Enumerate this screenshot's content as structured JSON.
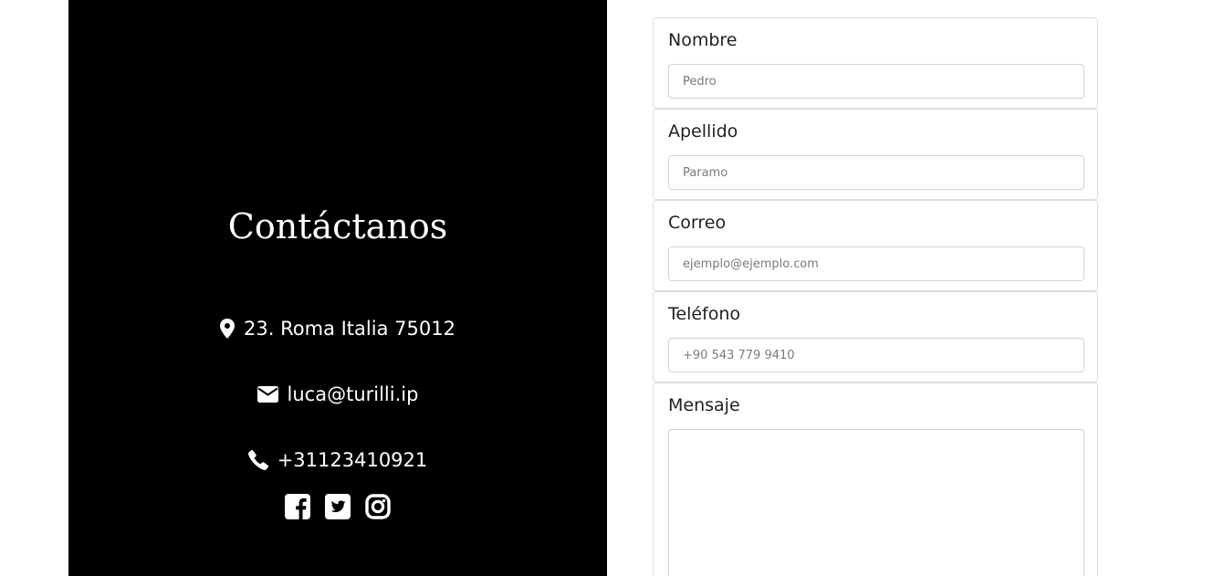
{
  "contact": {
    "title": "Contáctanos",
    "address": "23. Roma Italia 75012",
    "email": "luca@turilli.ip",
    "phone": "+31123410921",
    "address_icon": "map-marker-icon",
    "email_icon": "envelope-icon",
    "phone_icon": "phone-icon",
    "social": [
      "facebook-icon",
      "twitter-icon",
      "instagram-icon"
    ],
    "background_color": "#000000",
    "text_color": "#ffffff"
  },
  "form": {
    "fields": [
      {
        "label": "Nombre",
        "placeholder": "Pedro"
      },
      {
        "label": "Apellido",
        "placeholder": "Paramo"
      },
      {
        "label": "Correo",
        "placeholder": "ejemplo@ejemplo.com"
      },
      {
        "label": "Teléfono",
        "placeholder": "+90 543 779 9410"
      }
    ],
    "message_label": "Mensaje",
    "message_value": ""
  }
}
